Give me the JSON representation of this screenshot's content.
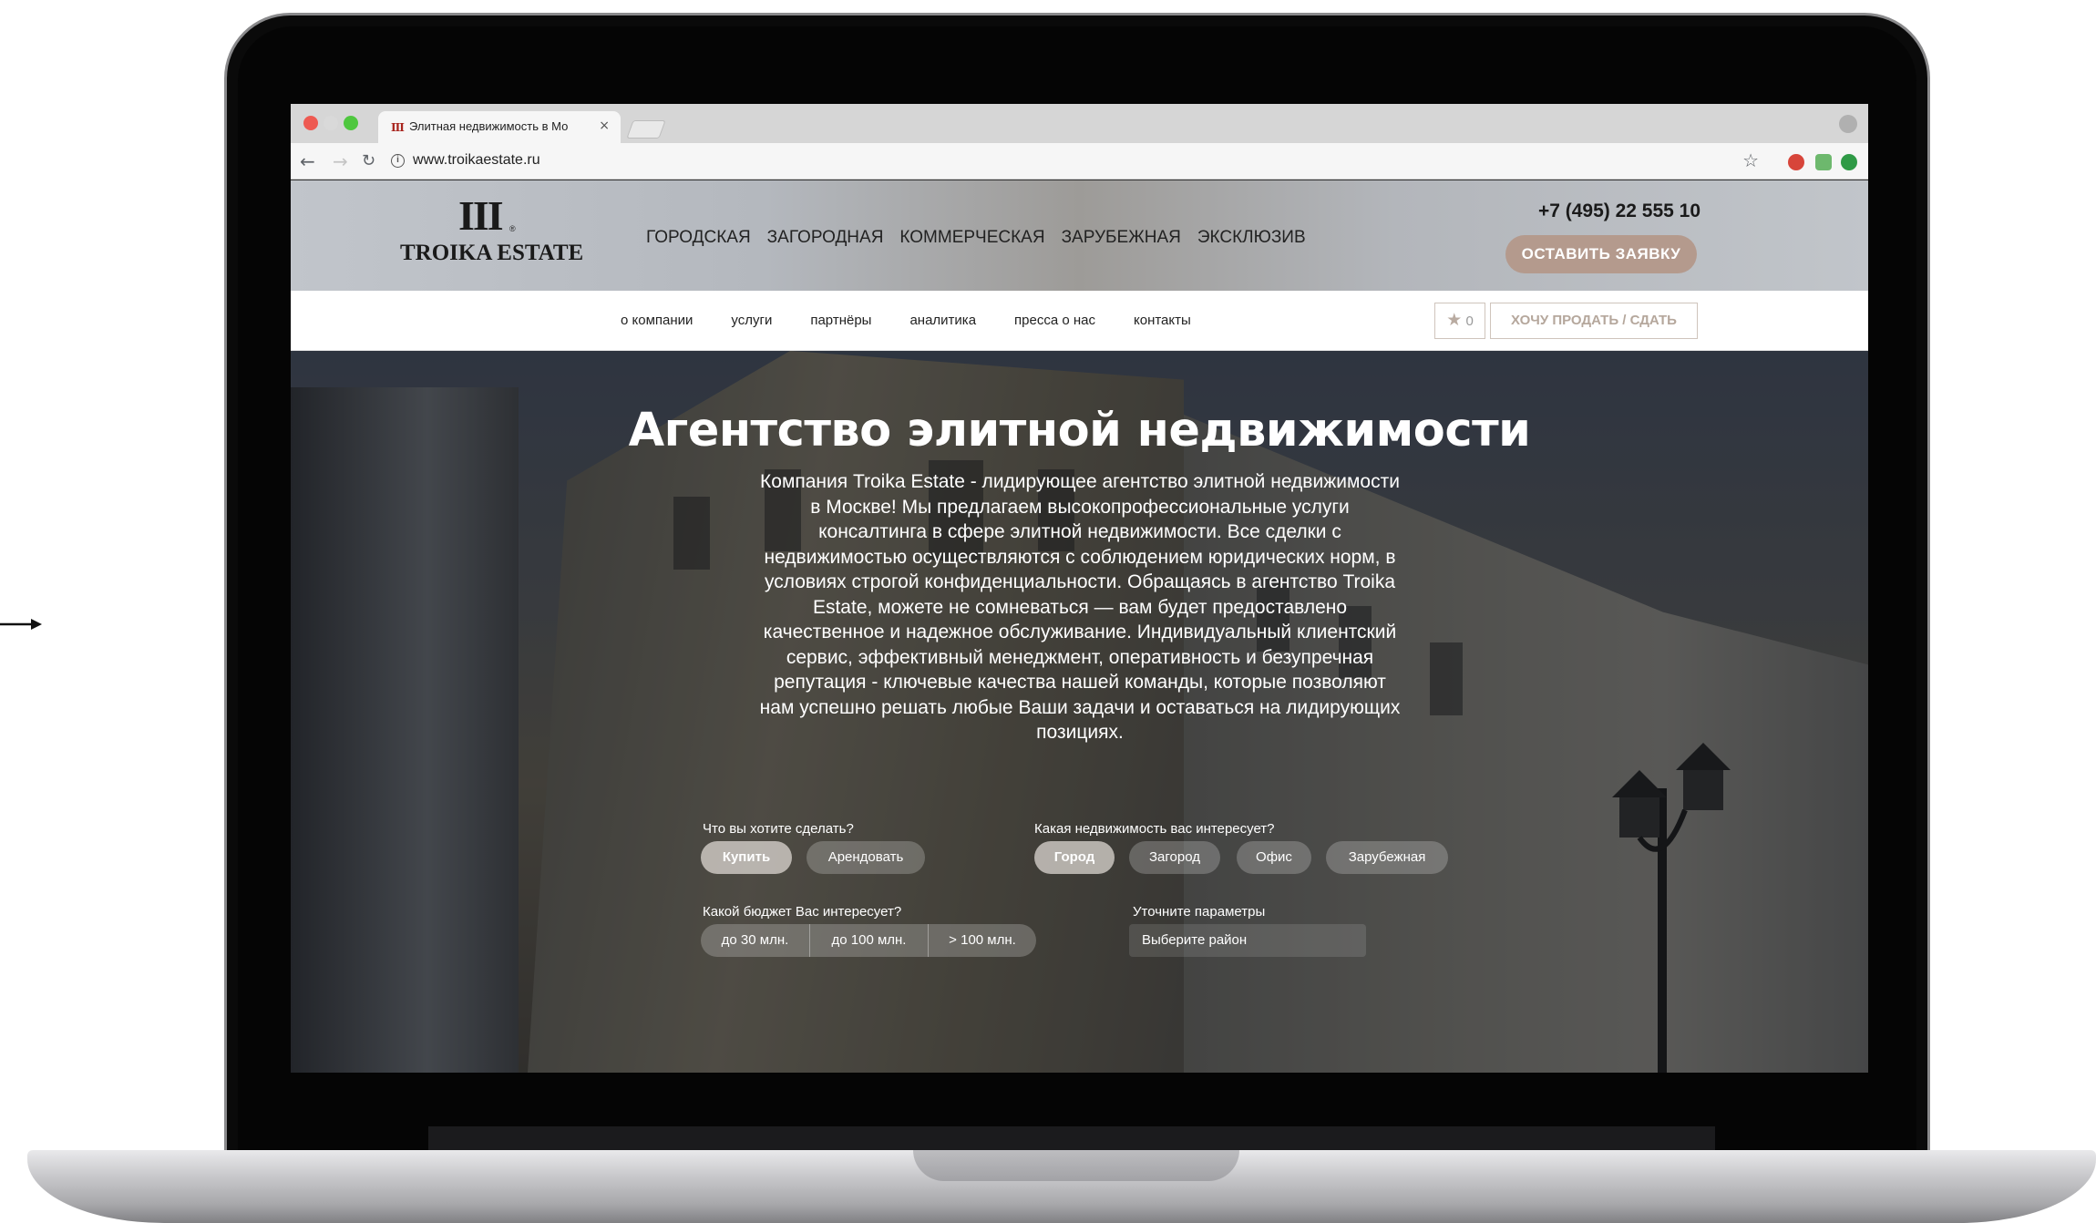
{
  "browser": {
    "tab_title": "Элитная недвижимость в Мо",
    "tab_close": "×",
    "url": "www.troikaestate.ru",
    "info_icon": "i"
  },
  "header": {
    "logo_mark": "III",
    "logo_reg": "®",
    "logo_text": "TROIKA ESTATE",
    "nav": [
      "ГОРОДСКАЯ",
      "ЗАГОРОДНАЯ",
      "КОММЕРЧЕСКАЯ",
      "ЗАРУБЕЖНАЯ",
      "ЭКСКЛЮЗИВ"
    ],
    "phone": "+7 (495) 22 555 10",
    "cta_label": "ОСТАВИТЬ ЗАЯВКУ"
  },
  "subnav": {
    "links": [
      "о компании",
      "услуги",
      "партнёры",
      "аналитика",
      "пресса о нас",
      "контакты"
    ],
    "favorites_count": "0",
    "sell_label": "ХОЧУ ПРОДАТЬ / СДАТЬ"
  },
  "hero": {
    "title": "Агентство элитной недвижимости",
    "text": "Компания Troika Estate - лидирующее агентство элитной недвижимости в Москве! Мы предлагаем высокопрофессиональные услуги консалтинга в сфере элитной недвижимости. Все сделки с недвижимостью осуществляются с соблюдением юридических норм, в условиях строгой конфиденциальности. Обращаясь в агентство Troika Estate, можете не сомневаться — вам будет предоставлено качественное и надежное обслуживание. Индивидуальный клиентский сервис, эффективный менеджмент, оперативность и безупречная репутация - ключевые качества нашей команды, которые позволяют нам успешно решать любые Ваши задачи и оставаться на лидирующих позициях."
  },
  "filters": {
    "action_label": "Что вы хотите сделать?",
    "actions": [
      "Купить",
      "Арендовать"
    ],
    "type_label": "Какая недвижимость вас интересует?",
    "types": [
      "Город",
      "Загород",
      "Офис",
      "Зарубежная"
    ],
    "budget_label": "Какой бюджет Вас интересует?",
    "budgets": [
      "до 30 млн.",
      "до 100 млн.",
      "> 100 млн."
    ],
    "params_label": "Уточните параметры",
    "district_placeholder": "Выберите район"
  }
}
